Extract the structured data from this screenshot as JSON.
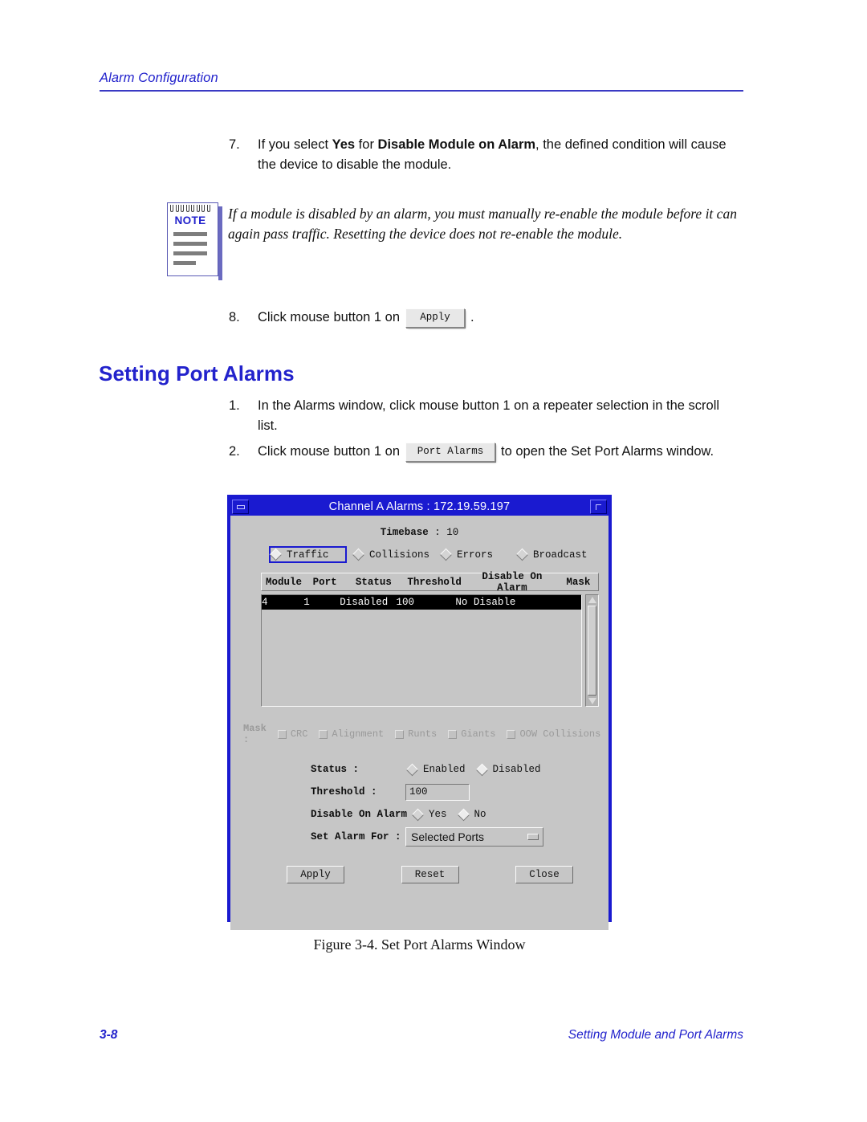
{
  "running_head": "Alarm Configuration",
  "steps": {
    "step7": {
      "num": "7.",
      "part1": "If you select ",
      "bold1": "Yes",
      "part2": " for ",
      "bold2": "Disable Module on Alarm",
      "part3": ", the defined condition will cause the device to disable the module."
    },
    "step8": {
      "num": "8.",
      "pre": "Click mouse button 1 on",
      "button": "Apply",
      "post": "."
    },
    "stepA": {
      "num": "1.",
      "text": "In the Alarms window, click mouse button 1 on a repeater selection in the scroll list."
    },
    "stepB": {
      "num": "2.",
      "pre": "Click mouse button 1 on",
      "button": "Port Alarms",
      "post": "to open the Set Port Alarms window."
    }
  },
  "note": {
    "badge": "NOTE",
    "text": "If a module is disabled by an alarm, you must manually re-enable the module before it can again pass traffic. Resetting the device does not re-enable the module."
  },
  "heading": "Setting Port Alarms",
  "dialog": {
    "title": "Channel A Alarms : 172.19.59.197",
    "minimize_icon": "minimize-icon",
    "maximize_icon": "maximize-icon",
    "timebase_label": "Timebase",
    "timebase_sep": " : ",
    "timebase_value": "10",
    "alarm_types": [
      {
        "label": "Traffic",
        "selected": true,
        "focused": true
      },
      {
        "label": "Collisions",
        "selected": false,
        "focused": false
      },
      {
        "label": "Errors",
        "selected": false,
        "focused": false
      },
      {
        "label": "Broadcast",
        "selected": false,
        "focused": false
      }
    ],
    "table": {
      "columns": [
        "Module",
        "Port",
        "Status",
        "Threshold",
        "Disable On Alarm",
        "Mask"
      ],
      "rows": [
        {
          "module": "4",
          "port": "1",
          "status": "Disabled",
          "threshold": "100",
          "disable_on_alarm": "No Disable",
          "mask": "",
          "selected": true
        }
      ]
    },
    "scrollbar": {
      "up_icon": "scroll-up-arrow-icon",
      "down_icon": "scroll-down-arrow-icon"
    },
    "mask": {
      "label": "Mask :",
      "options": [
        "CRC",
        "Alignment",
        "Runts",
        "Giants",
        "OOW Collisions"
      ],
      "disabled": true
    },
    "status": {
      "label": "Status :",
      "options": [
        {
          "label": "Enabled",
          "selected": false
        },
        {
          "label": "Disabled",
          "selected": true
        }
      ]
    },
    "threshold": {
      "label": "Threshold :",
      "value": "100"
    },
    "disable_on_alarm": {
      "label": "Disable On Alarm :",
      "options": [
        {
          "label": "Yes",
          "selected": false
        },
        {
          "label": "No",
          "selected": true
        }
      ]
    },
    "set_alarm_for": {
      "label": "Set Alarm For :",
      "value": "Selected Ports"
    },
    "buttons": [
      "Apply",
      "Reset",
      "Close"
    ]
  },
  "caption": "Figure 3-4.  Set Port Alarms Window",
  "footer": {
    "page": "3-8",
    "section": "Setting Module and Port Alarms"
  },
  "colors": {
    "accent_blue": "#2222cc",
    "titlebar_blue": "#1a1ad0",
    "dialog_gray": "#c6c6c6",
    "selected_row": "#000000"
  }
}
